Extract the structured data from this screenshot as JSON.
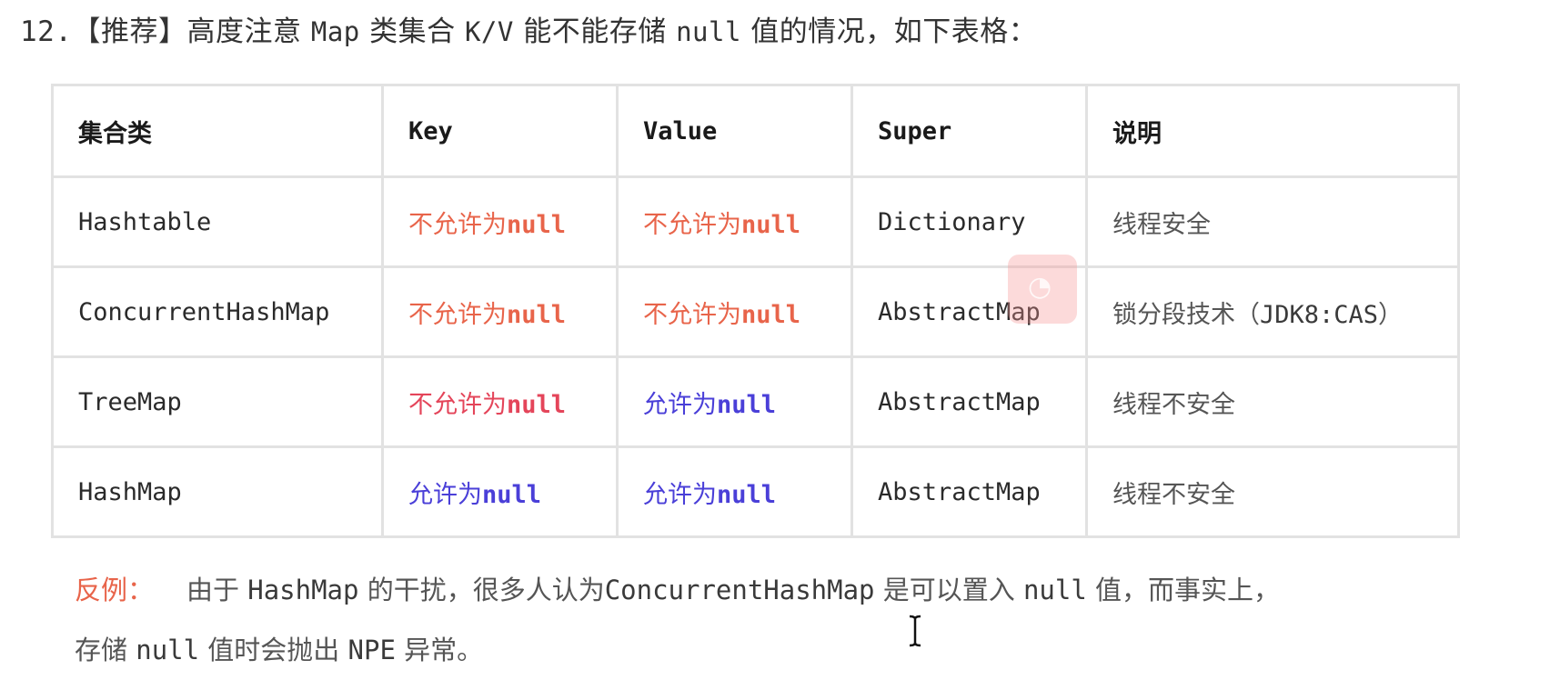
{
  "heading": {
    "number": "12.",
    "tag": "【推荐】",
    "parts": [
      "高度注意",
      "Map",
      "类集合",
      "K/V",
      "能不能存储",
      "null",
      "值的情况，如下表格："
    ]
  },
  "table": {
    "headers": [
      "集合类",
      "Key",
      "Value",
      "Super",
      "说明"
    ],
    "rows": [
      {
        "class": "Hashtable",
        "key": {
          "prefix": "不允许为",
          "code": "null",
          "allowed": false
        },
        "value": {
          "prefix": "不允许为",
          "code": "null",
          "allowed": false
        },
        "super": "Dictionary",
        "desc": {
          "text": "线程安全",
          "code": ""
        }
      },
      {
        "class": "ConcurrentHashMap",
        "key": {
          "prefix": "不允许为",
          "code": "null",
          "allowed": false
        },
        "value": {
          "prefix": "不允许为",
          "code": "null",
          "allowed": false
        },
        "super": "AbstractMap",
        "desc": {
          "text": "锁分段技术（",
          "code": "JDK8:CAS",
          "suffix": "）"
        }
      },
      {
        "class": "TreeMap",
        "key": {
          "prefix": "不允许为",
          "code": "null",
          "allowed": false
        },
        "value": {
          "prefix": "允许为",
          "code": "null",
          "allowed": true
        },
        "super": "AbstractMap",
        "desc": {
          "text": "线程不安全",
          "code": ""
        }
      },
      {
        "class": "HashMap",
        "key": {
          "prefix": "允许为",
          "code": "null",
          "allowed": true
        },
        "value": {
          "prefix": "允许为",
          "code": "null",
          "allowed": true
        },
        "super": "AbstractMap",
        "desc": {
          "text": "线程不安全",
          "code": ""
        }
      }
    ]
  },
  "note": {
    "label": "反例：",
    "line1": [
      "由于",
      "HashMap",
      "的干扰，很多人认为",
      "ConcurrentHashMap",
      "是可以置入",
      "null",
      "值，而事实上，"
    ],
    "line2": [
      "存储",
      "null",
      "值时会抛出",
      "NPE",
      "异常。"
    ]
  },
  "colors": {
    "deny": "#e8644a",
    "allow": "#4a3fd8",
    "border": "#e2e2e2",
    "label": "#e8644a"
  }
}
